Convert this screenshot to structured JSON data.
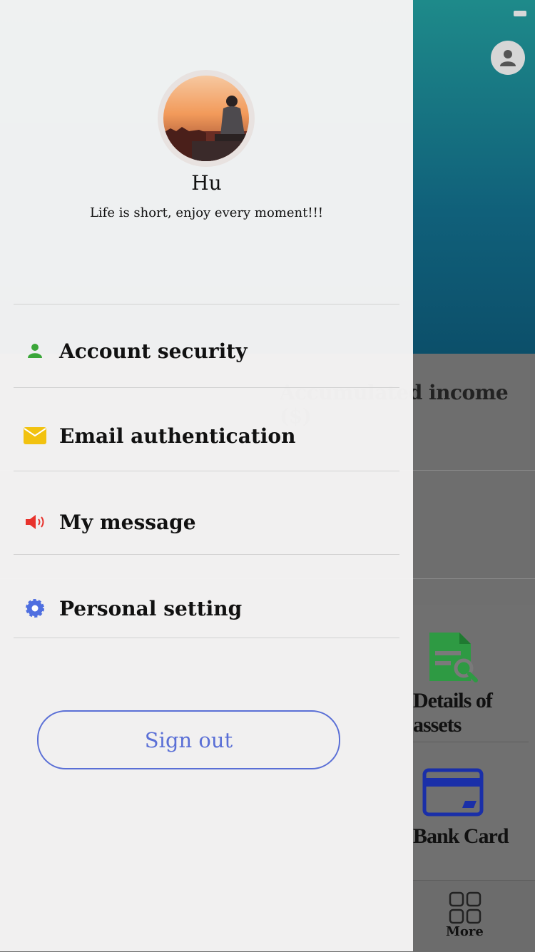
{
  "underlay": {
    "accumulated_income_label": "Accumulated income ($)",
    "details_of_assets": "Details of assets",
    "bank_card": "Bank Card",
    "tab_more": "More"
  },
  "drawer": {
    "user_name": "Hu",
    "user_motto": "Life is short, enjoy every moment!!!",
    "menu": [
      {
        "label": "Account security",
        "icon": "person-icon",
        "color": "#3aa639"
      },
      {
        "label": "Email authentication",
        "icon": "envelope-icon",
        "color": "#f2c20f"
      },
      {
        "label": "My message",
        "icon": "speaker-icon",
        "color": "#e8322c"
      },
      {
        "label": "Personal setting",
        "icon": "gear-icon",
        "color": "#4f6fe0"
      }
    ],
    "sign_out": "Sign out"
  },
  "colors": {
    "accent": "#5a6fd6",
    "hero_top": "#1e8a8a",
    "hero_bottom": "#0c4f6a",
    "assets_icon": "#2e9a43",
    "bank_icon": "#1a2fa8"
  }
}
